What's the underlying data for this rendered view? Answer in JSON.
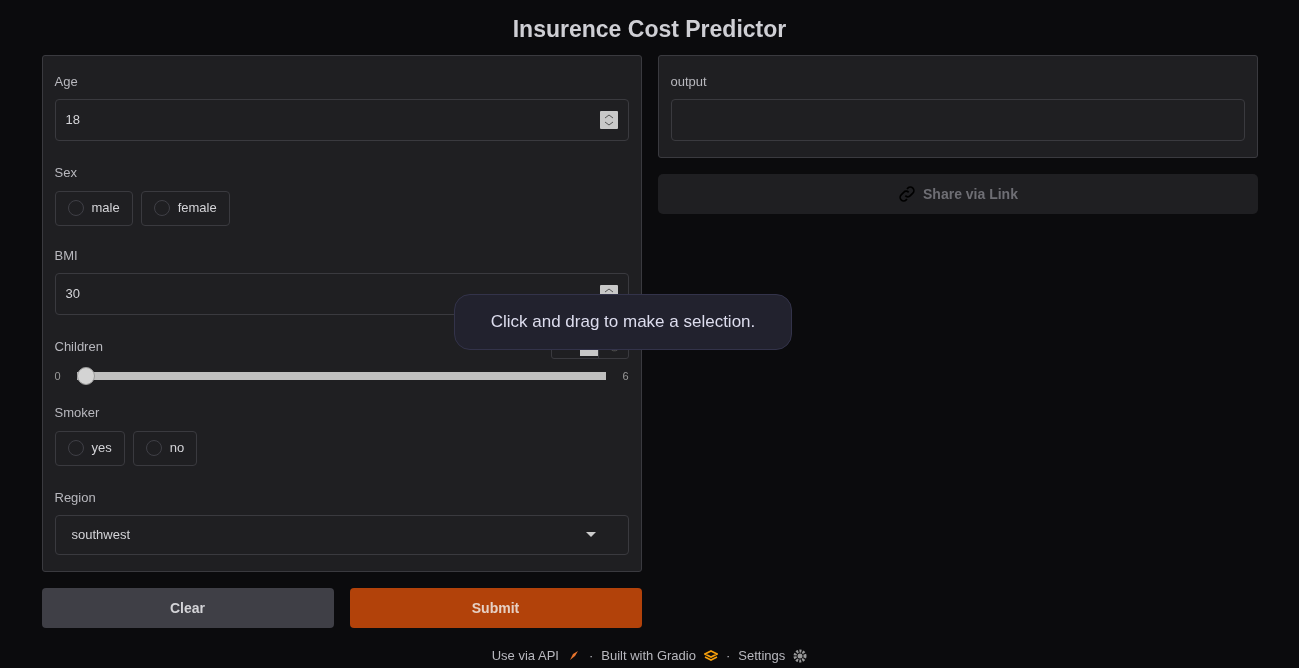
{
  "title": "Insurence Cost Predictor",
  "inputs": {
    "age": {
      "label": "Age",
      "value": "18"
    },
    "sex": {
      "label": "Sex",
      "options": [
        {
          "label": "male",
          "selected": false
        },
        {
          "label": "female",
          "selected": false
        }
      ]
    },
    "bmi": {
      "label": "BMI",
      "value": "30"
    },
    "children": {
      "label": "Children",
      "min": "0",
      "max": "6",
      "level": 0
    },
    "smoker": {
      "label": "Smoker",
      "options": [
        {
          "label": "yes",
          "selected": false
        },
        {
          "label": "no",
          "selected": false
        }
      ]
    },
    "region": {
      "label": "Region",
      "value": "southwest"
    }
  },
  "buttons": [
    {
      "label": "Clear",
      "kind": "secondary"
    },
    {
      "label": "Submit",
      "kind": "primary"
    }
  ],
  "output": {
    "label": "output"
  },
  "share_button": {
    "label": "Share via Link"
  },
  "tooltip": "Click and drag to make a selection.",
  "footer_separator": "·",
  "footer": [
    {
      "label": "Use via API",
      "kind": "api"
    },
    {
      "label": "Built with Gradio",
      "kind": "gradio"
    },
    {
      "label": "Settings",
      "kind": "settings"
    }
  ]
}
